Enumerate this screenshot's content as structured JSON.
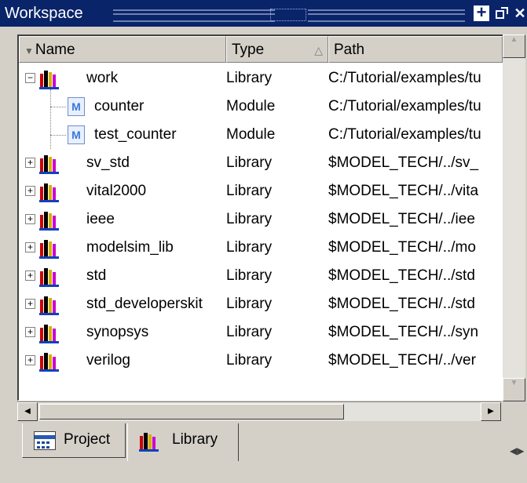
{
  "window": {
    "title": "Workspace",
    "buttons": [
      "plus-icon",
      "undock-icon",
      "close-icon"
    ]
  },
  "columns": {
    "name": "Name",
    "type": "Type",
    "path": "Path"
  },
  "rows": [
    {
      "name": "work",
      "type": "Library",
      "path": "C:/Tutorial/examples/tu",
      "icon": "library-icon",
      "expander": "−"
    },
    {
      "name": "counter",
      "type": "Module",
      "path": "C:/Tutorial/examples/tu",
      "icon": "module-icon"
    },
    {
      "name": "test_counter",
      "type": "Module",
      "path": "C:/Tutorial/examples/tu",
      "icon": "module-icon"
    },
    {
      "name": "sv_std",
      "type": "Library",
      "path": "$MODEL_TECH/../sv_",
      "icon": "library-icon",
      "expander": "+"
    },
    {
      "name": "vital2000",
      "type": "Library",
      "path": "$MODEL_TECH/../vita",
      "icon": "library-icon",
      "expander": "+"
    },
    {
      "name": "ieee",
      "type": "Library",
      "path": "$MODEL_TECH/../iee",
      "icon": "library-icon",
      "expander": "+"
    },
    {
      "name": "modelsim_lib",
      "type": "Library",
      "path": "$MODEL_TECH/../mo",
      "icon": "library-icon",
      "expander": "+"
    },
    {
      "name": "std",
      "type": "Library",
      "path": "$MODEL_TECH/../std",
      "icon": "library-icon",
      "expander": "+"
    },
    {
      "name": "std_developerskit",
      "type": "Library",
      "path": "$MODEL_TECH/../std",
      "icon": "library-icon",
      "expander": "+"
    },
    {
      "name": "synopsys",
      "type": "Library",
      "path": "$MODEL_TECH/../syn",
      "icon": "library-icon",
      "expander": "+"
    },
    {
      "name": "verilog",
      "type": "Library",
      "path": "$MODEL_TECH/../ver",
      "icon": "library-icon",
      "expander": "+"
    }
  ],
  "tabs": [
    {
      "label": "Project",
      "icon": "project-icon"
    },
    {
      "label": "Library",
      "icon": "library-icon",
      "active": true
    }
  ],
  "colors": {
    "title_bg": "#0a246a",
    "panel_bg": "#d4d0c8",
    "list_bg": "#ffffff"
  }
}
